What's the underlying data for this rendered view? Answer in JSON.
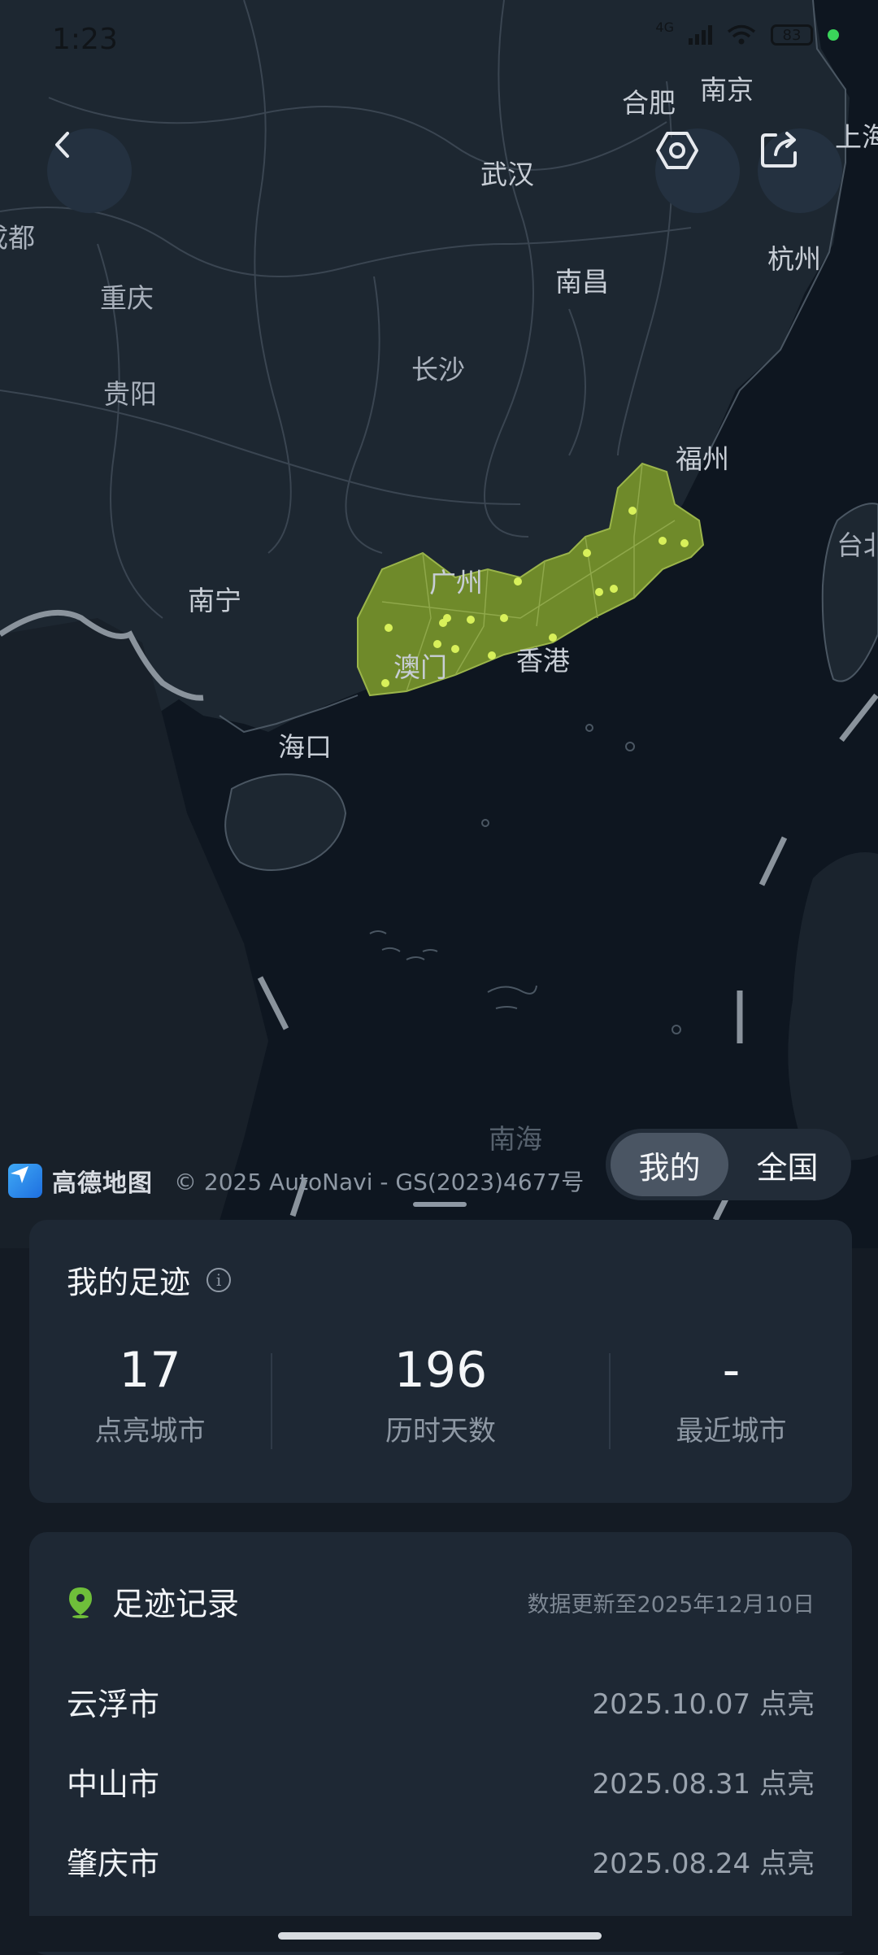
{
  "status_bar": {
    "time": "1:23",
    "network": "4G",
    "battery": "83"
  },
  "map": {
    "labels": {
      "hefei": "合肥",
      "nanjing": "南京",
      "shanghai": "上海",
      "wuhan": "武汉",
      "hangzhou": "杭州",
      "chengdu": "成都",
      "chongqing": "重庆",
      "nanchang": "南昌",
      "changsha": "长沙",
      "guiyang": "贵阳",
      "fuzhou": "福州",
      "taibei": "台北",
      "nanning": "南宁",
      "guangzhou": "广州",
      "macau": "澳门",
      "hongkong": "香港",
      "haikou": "海口",
      "nanhai": "南海"
    },
    "highlight_color": "#6f8a2a",
    "city_dot_color": "#d8f05a",
    "attribution": {
      "brand": "高德地图",
      "copyright": "© 2025 AutoNavi - GS(2023)4677号"
    }
  },
  "scope_toggle": {
    "options": [
      "我的",
      "全国"
    ],
    "selected": "我的"
  },
  "summary": {
    "title": "我的足迹",
    "stats": [
      {
        "value": "17",
        "label": "点亮城市"
      },
      {
        "value": "196",
        "label": "历时天数"
      },
      {
        "value": "-",
        "label": "最近城市"
      }
    ]
  },
  "records": {
    "title": "足迹记录",
    "updated": "数据更新至2025年12月10日",
    "items": [
      {
        "city": "云浮市",
        "date": "2025.10.07 点亮"
      },
      {
        "city": "中山市",
        "date": "2025.08.31 点亮"
      },
      {
        "city": "肇庆市",
        "date": "2025.08.24 点亮"
      }
    ]
  }
}
